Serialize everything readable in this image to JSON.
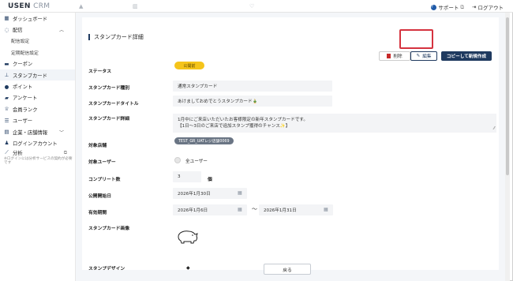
{
  "header": {
    "logo_main": "USEN",
    "logo_sub": "CRM",
    "support": "サポート",
    "logout": "ログアウト"
  },
  "sidebar": {
    "items": [
      {
        "label": "ダッシュボード",
        "icon": "dashboard-icon"
      },
      {
        "label": "配信",
        "icon": "broadcast-icon"
      },
      {
        "label": "配信設定",
        "icon": ""
      },
      {
        "label": "定期配信設定",
        "icon": ""
      },
      {
        "label": "クーポン",
        "icon": "coupon-icon"
      },
      {
        "label": "スタンプカード",
        "icon": "stamp-icon"
      },
      {
        "label": "ポイント",
        "icon": "point-icon"
      },
      {
        "label": "アンケート",
        "icon": "survey-icon"
      },
      {
        "label": "会員ランク",
        "icon": "rank-icon"
      },
      {
        "label": "ユーザー",
        "icon": "user-icon"
      },
      {
        "label": "企業・店舗情報",
        "icon": "store-icon"
      },
      {
        "label": "ログインアカウント",
        "icon": "account-icon"
      },
      {
        "label": "分析",
        "icon": "analytics-icon"
      }
    ],
    "analytics_note": "※ログインには分析サービスの契約が必要です"
  },
  "detail": {
    "section_title": "スタンプカード詳細",
    "buttons": {
      "delete": "削除",
      "edit": "編集",
      "copy": "コピーして新規作成",
      "back": "戻る"
    },
    "labels": {
      "status": "ステータス",
      "type": "スタンプカード種別",
      "title": "スタンプカードタイトル",
      "detail": "スタンプカード詳細",
      "store": "対象店舗",
      "user": "対象ユーザー",
      "complete": "コンプリート数",
      "publish_start": "公開開始日",
      "valid_period": "有効期間",
      "image": "スタンプカード画像",
      "stamp_design": "スタンプデザイン"
    },
    "values": {
      "status": "公開前",
      "type": "通常スタンプカード",
      "title": "あけましておめでとうスタンプカード🎍",
      "detail_line1": "1月中にご来店いただいたお客様限定の新年スタンプカードです。",
      "detail_line2": "【1日〜3日のご来店で追加スタンプ獲得のチャンス✨】",
      "store": "TEST_GR_UATレジ店舗0069",
      "user": "全ユーザー",
      "complete": "3",
      "complete_unit": "個",
      "publish_start": "2026年1月30日",
      "valid_from": "2026年1月6日",
      "valid_to": "2026年1月31日",
      "tilde": "〜"
    }
  },
  "colors": {
    "brand_navy": "#1f3a5f",
    "status_yellow": "#f5c41a",
    "highlight_red": "#d5333f",
    "delete_red": "#c72a2a"
  }
}
